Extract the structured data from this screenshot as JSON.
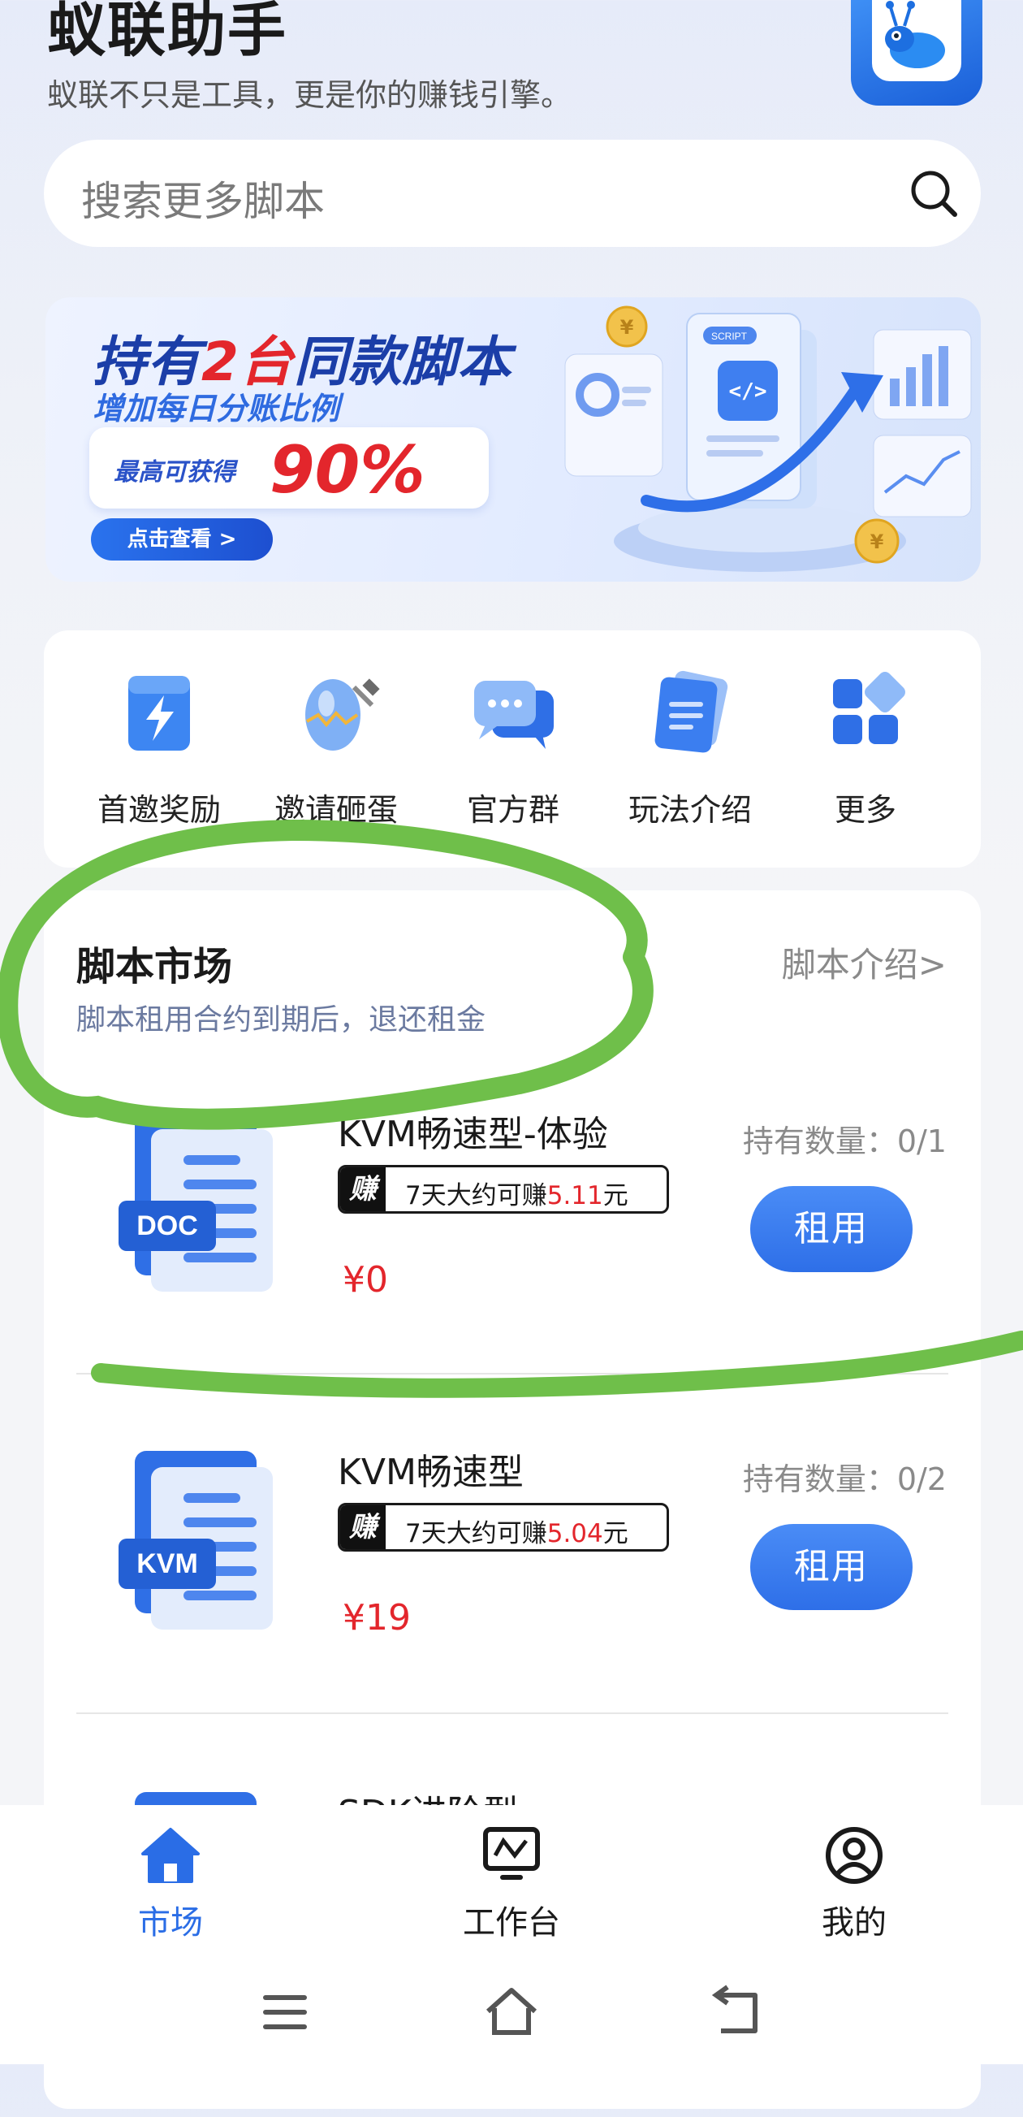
{
  "header": {
    "title": "蚁联助手",
    "subtitle": "蚁联不只是工具，更是你的赚钱引擎。"
  },
  "search": {
    "placeholder": "搜索更多脚本"
  },
  "banner": {
    "headline_a": "持有",
    "headline_b": "2台",
    "headline_c": "同款脚本",
    "subline": "增加每日分账比例",
    "box_label": "最高可获得",
    "box_value": "90%",
    "button": "点击查看 >",
    "art_label": "SCRIPT"
  },
  "quick_actions": [
    {
      "label": "首邀奖励",
      "icon": "lightning-gift-icon"
    },
    {
      "label": "邀请砸蛋",
      "icon": "golden-egg-icon"
    },
    {
      "label": "官方群",
      "icon": "chat-bubbles-icon"
    },
    {
      "label": "玩法介绍",
      "icon": "document-icon"
    },
    {
      "label": "更多",
      "icon": "grid-icon"
    }
  ],
  "market": {
    "title": "脚本市场",
    "description": "脚本租用合约到期后，退还租金",
    "intro_link": "脚本介绍>",
    "products": [
      {
        "name": "KVM畅速型-体验",
        "badge": "DOC",
        "earn_tag": "赚",
        "earn_prefix": "7天大约可赚",
        "earn_amount": "5.11",
        "earn_suffix": "元",
        "price": "¥0",
        "holding": "持有数量：0/1",
        "button": "租用"
      },
      {
        "name": "KVM畅速型",
        "badge": "KVM",
        "earn_tag": "赚",
        "earn_prefix": "7天大约可赚",
        "earn_amount": "5.04",
        "earn_suffix": "元",
        "price": "¥19",
        "holding": "持有数量：0/2",
        "button": "租用"
      },
      {
        "name": "SDK进阶型"
      }
    ]
  },
  "tabbar": {
    "tabs": [
      {
        "label": "市场",
        "active": true
      },
      {
        "label": "工作台",
        "active": false
      },
      {
        "label": "我的",
        "active": false
      }
    ]
  },
  "colors": {
    "accent": "#2a6de6",
    "price_red": "#e3262c",
    "annotation_green": "#6fbf4a"
  }
}
